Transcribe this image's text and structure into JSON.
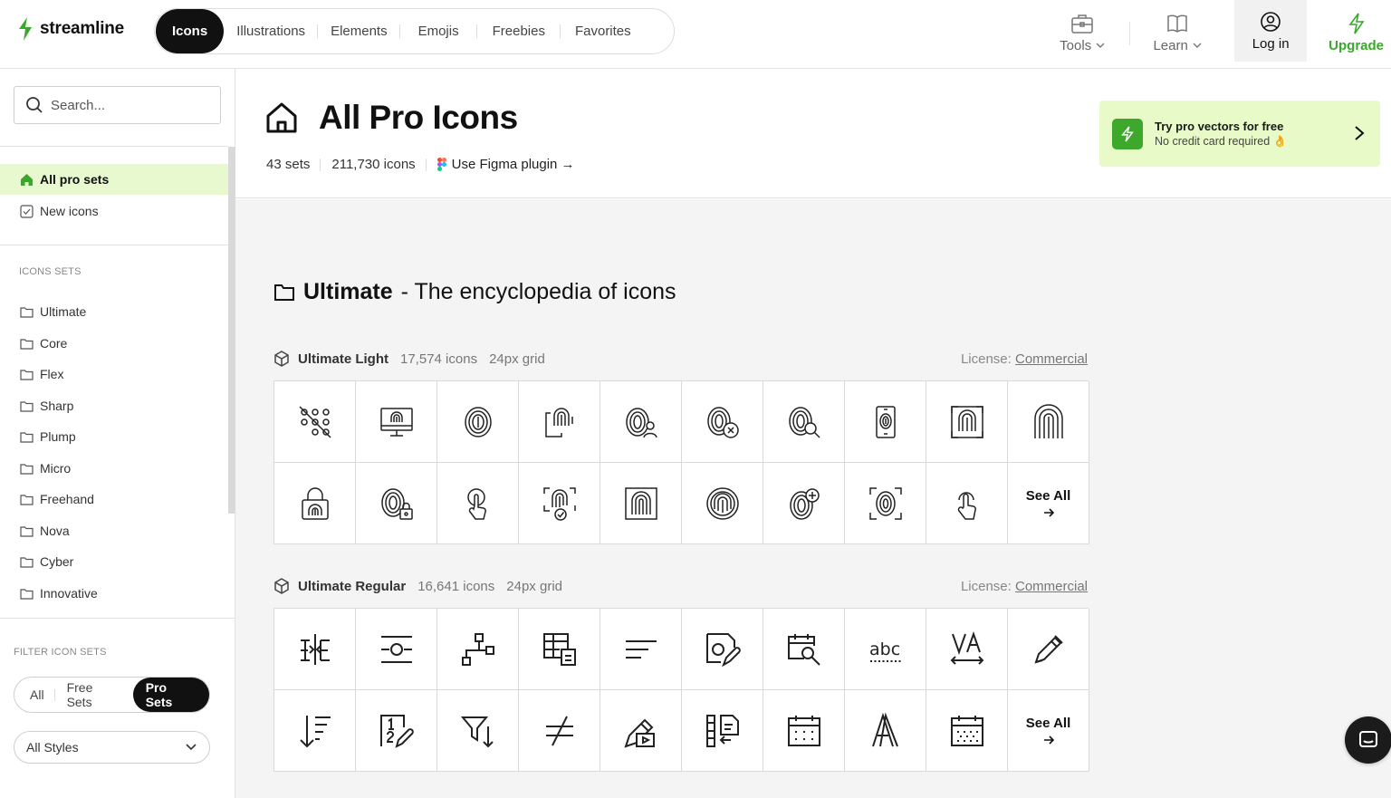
{
  "brand": {
    "name": "streamline",
    "accent": "#3aa82a",
    "active_bg": "#e9f9cf"
  },
  "nav": {
    "tabs": [
      {
        "label": "Icons",
        "active": true
      },
      {
        "label": "Illustrations"
      },
      {
        "label": "Elements"
      },
      {
        "label": "Emojis"
      },
      {
        "label": "Freebies"
      },
      {
        "label": "Favorites"
      }
    ]
  },
  "top_actions": {
    "tools": {
      "label": "Tools",
      "icon": "briefcase-icon"
    },
    "learn": {
      "label": "Learn",
      "icon": "book-icon"
    },
    "login": {
      "label": "Log in",
      "icon": "user-circle-icon"
    },
    "upgrade": {
      "label": "Upgrade",
      "icon": "lightning-icon"
    }
  },
  "sidebar": {
    "search_placeholder": "Search...",
    "primary": [
      {
        "label": "All pro sets",
        "icon": "home-icon",
        "active": true
      },
      {
        "label": "New icons",
        "icon": "checkbox-icon"
      }
    ],
    "sets_heading": "ICONS SETS",
    "sets": [
      "Ultimate",
      "Core",
      "Flex",
      "Sharp",
      "Plump",
      "Micro",
      "Freehand",
      "Nova",
      "Cyber",
      "Innovative"
    ],
    "filter_heading": "FILTER ICON SETS",
    "filters": [
      {
        "label": "All"
      },
      {
        "label": "Free Sets"
      },
      {
        "label": "Pro Sets",
        "active": true
      }
    ],
    "style_select": "All Styles"
  },
  "header": {
    "title": "All Pro Icons",
    "sets": "43 sets",
    "icons": "211,730 icons",
    "figma_link": "Use Figma plugin →",
    "promo": {
      "title": "Try pro vectors for free",
      "subtitle": "No credit card required 👌"
    }
  },
  "collection": {
    "name": "Ultimate",
    "tagline": "- The encyclopedia of icons",
    "subsets": [
      {
        "name": "Ultimate Light",
        "count": "17,574 icons",
        "grid": "24px grid",
        "license_label": "License:",
        "license_link": "Commercial",
        "see_all": "See All",
        "icons": [
          "fingerprint-dots-icon",
          "monitor-fingerprint-icon",
          "fingerprint-icon",
          "phone-fingerprint-icon",
          "fingerprint-user-icon",
          "fingerprint-remove-icon",
          "fingerprint-search-icon",
          "mobile-fingerprint-icon",
          "fingerprint-frame-icon",
          "fingerprint-lines-icon",
          "padlock-fingerprint-icon",
          "fingerprint-lock-icon",
          "touch-finger-icon",
          "fingerprint-check-icon",
          "fingerprint-square-icon",
          "fingerprint-circle-icon",
          "fingerprint-add-icon",
          "fingerprint-scan-icon",
          "finger-tap-icon"
        ]
      },
      {
        "name": "Ultimate Regular",
        "count": "16,641 icons",
        "grid": "24px grid",
        "license_label": "License:",
        "license_link": "Commercial",
        "see_all": "See All",
        "icons": [
          "text-flip-icon",
          "align-image-icon",
          "hierarchy-nodes-icon",
          "table-document-icon",
          "align-left-icon",
          "image-edit-icon",
          "calendar-search-icon",
          "spell-check-icon",
          "kerning-icon",
          "pen-edit-icon",
          "sort-descending-icon",
          "numbered-list-edit-icon",
          "filter-descending-icon",
          "not-equal-icon",
          "file-play-icon",
          "file-return-icon",
          "calendar-grid-icon",
          "typography-a-icon",
          "calendar-dots-icon"
        ]
      }
    ]
  }
}
